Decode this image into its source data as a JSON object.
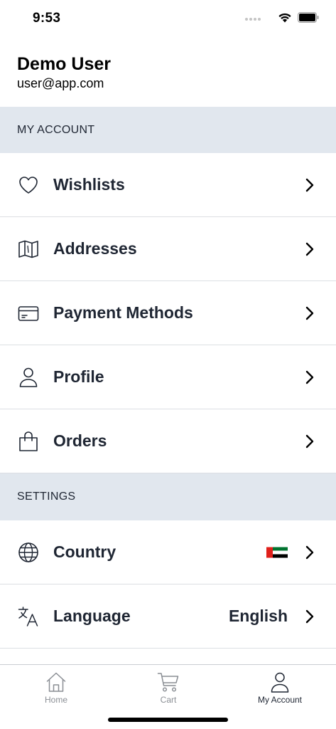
{
  "status_bar": {
    "time": "9:53"
  },
  "user": {
    "name": "Demo User",
    "email": "user@app.com"
  },
  "sections": {
    "account": {
      "title": "MY ACCOUNT",
      "items": [
        {
          "label": "Wishlists",
          "icon": "heart-icon"
        },
        {
          "label": "Addresses",
          "icon": "map-icon"
        },
        {
          "label": "Payment Methods",
          "icon": "credit-card-icon"
        },
        {
          "label": "Profile",
          "icon": "person-icon"
        },
        {
          "label": "Orders",
          "icon": "shopping-bag-icon"
        }
      ]
    },
    "settings": {
      "title": "SETTINGS",
      "items": [
        {
          "label": "Country",
          "icon": "globe-icon",
          "value_icon": "uae-flag-icon"
        },
        {
          "label": "Language",
          "icon": "translate-icon",
          "value": "English"
        }
      ]
    }
  },
  "tab_bar": {
    "active": "My Account",
    "tabs": [
      {
        "label": "Home",
        "icon": "home-icon"
      },
      {
        "label": "Cart",
        "icon": "cart-icon"
      },
      {
        "label": "My Account",
        "icon": "person-icon"
      }
    ]
  },
  "colors": {
    "section_bg": "#e1e7ee",
    "text": "#1f2633",
    "flag_red": "#e0201b",
    "flag_green": "#00732f",
    "flag_black": "#000000"
  }
}
